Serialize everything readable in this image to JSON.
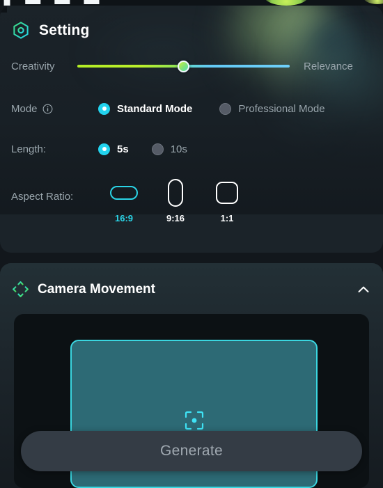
{
  "top_strip": {
    "cut_off_text": "▮ ▬ ▬ ▬"
  },
  "settings": {
    "icon": "hexagon-setting-icon",
    "title": "Setting",
    "slider": {
      "name": "creativity-relevance-slider",
      "left_label": "Creativity",
      "right_label": "Relevance",
      "value_percent": 50
    },
    "mode": {
      "label": "Mode",
      "info_icon": "info-circle-icon",
      "options": [
        {
          "label": "Standard Mode",
          "selected": true
        },
        {
          "label": "Professional Mode",
          "selected": false
        }
      ]
    },
    "length": {
      "label": "Length:",
      "options": [
        {
          "label": "5s",
          "selected": true
        },
        {
          "label": "10s",
          "selected": false
        }
      ]
    },
    "aspect_ratio": {
      "label": "Aspect Ratio:",
      "options": [
        {
          "label": "16:9",
          "shape": "wide-rounded-rect",
          "selected": true
        },
        {
          "label": "9:16",
          "shape": "tall-rounded-rect",
          "selected": false
        },
        {
          "label": "1:1",
          "shape": "square-rounded",
          "selected": false
        }
      ]
    }
  },
  "camera_movement": {
    "icon": "four-way-move-icon",
    "title": "Camera Movement",
    "collapse_icon": "chevron-up-icon",
    "preview": {
      "center_icon": "focus-target-icon"
    }
  },
  "footer": {
    "generate_label": "Generate",
    "generate_disabled": true
  },
  "colors": {
    "accent_cyan": "#22d3ee",
    "accent_green": "#35d07f",
    "slider_left": "#b4ee25",
    "slider_right": "#6fd0fa",
    "panel_bg": "#1b2329",
    "page_bg": "#12171c",
    "preview_fill": "#2d6a75",
    "preview_border": "#3ad6e0",
    "button_bg": "#343c45",
    "button_text": "#a0a9b1",
    "muted_text": "#9aa6ad"
  }
}
